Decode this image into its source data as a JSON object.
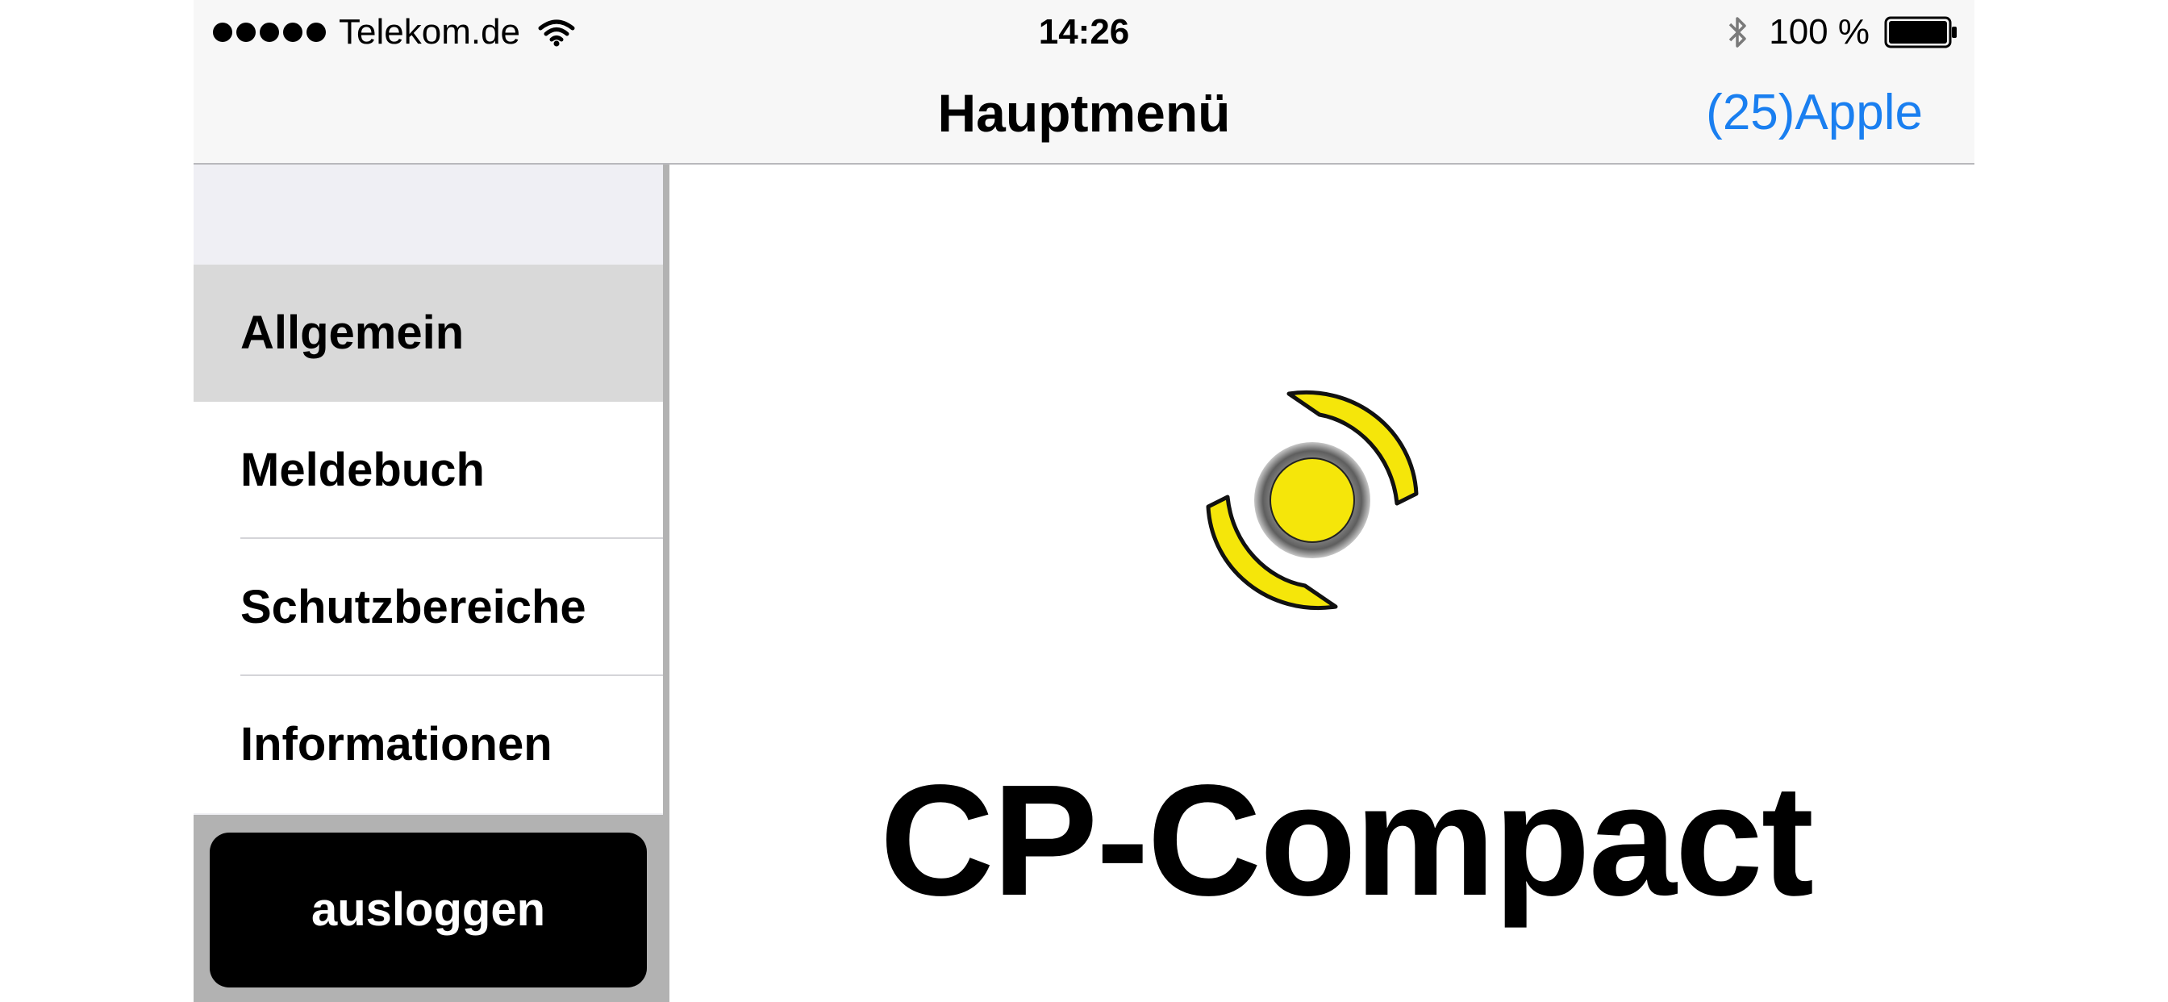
{
  "status_bar": {
    "carrier": "Telekom.de",
    "time": "14:26",
    "battery_text": "100 %",
    "signal_bars": 5,
    "icons": [
      "signal-dots-icon",
      "wifi-icon",
      "bluetooth-icon",
      "battery-icon"
    ]
  },
  "nav": {
    "title": "Hauptmenü",
    "right_label": "(25)Apple",
    "accent_color": "#1a7ff0"
  },
  "sidebar": {
    "items": [
      {
        "label": "Allgemein",
        "selected": true
      },
      {
        "label": "Meldebuch",
        "selected": false
      },
      {
        "label": "Schutzbereiche",
        "selected": false
      },
      {
        "label": "Informationen",
        "selected": false
      }
    ],
    "logout_label": "ausloggen"
  },
  "content": {
    "brand_name": "CP-Compact",
    "logo_color": "#f5e60a"
  }
}
